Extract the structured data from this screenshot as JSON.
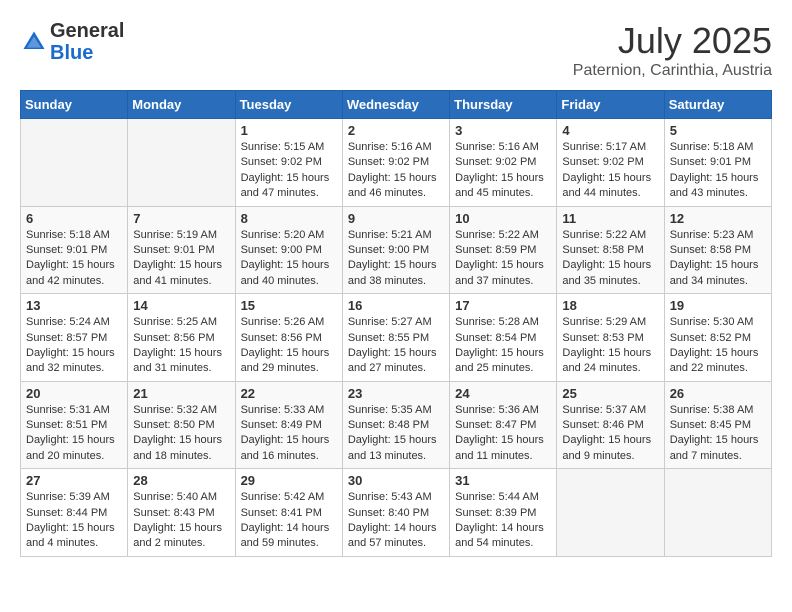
{
  "header": {
    "logo_general": "General",
    "logo_blue": "Blue",
    "month_year": "July 2025",
    "location": "Paternion, Carinthia, Austria"
  },
  "weekdays": [
    "Sunday",
    "Monday",
    "Tuesday",
    "Wednesday",
    "Thursday",
    "Friday",
    "Saturday"
  ],
  "weeks": [
    [
      {
        "day": "",
        "empty": true
      },
      {
        "day": "",
        "empty": true
      },
      {
        "day": "1",
        "sunrise": "5:15 AM",
        "sunset": "9:02 PM",
        "daylight": "15 hours and 47 minutes."
      },
      {
        "day": "2",
        "sunrise": "5:16 AM",
        "sunset": "9:02 PM",
        "daylight": "15 hours and 46 minutes."
      },
      {
        "day": "3",
        "sunrise": "5:16 AM",
        "sunset": "9:02 PM",
        "daylight": "15 hours and 45 minutes."
      },
      {
        "day": "4",
        "sunrise": "5:17 AM",
        "sunset": "9:02 PM",
        "daylight": "15 hours and 44 minutes."
      },
      {
        "day": "5",
        "sunrise": "5:18 AM",
        "sunset": "9:01 PM",
        "daylight": "15 hours and 43 minutes."
      }
    ],
    [
      {
        "day": "6",
        "sunrise": "5:18 AM",
        "sunset": "9:01 PM",
        "daylight": "15 hours and 42 minutes."
      },
      {
        "day": "7",
        "sunrise": "5:19 AM",
        "sunset": "9:01 PM",
        "daylight": "15 hours and 41 minutes."
      },
      {
        "day": "8",
        "sunrise": "5:20 AM",
        "sunset": "9:00 PM",
        "daylight": "15 hours and 40 minutes."
      },
      {
        "day": "9",
        "sunrise": "5:21 AM",
        "sunset": "9:00 PM",
        "daylight": "15 hours and 38 minutes."
      },
      {
        "day": "10",
        "sunrise": "5:22 AM",
        "sunset": "8:59 PM",
        "daylight": "15 hours and 37 minutes."
      },
      {
        "day": "11",
        "sunrise": "5:22 AM",
        "sunset": "8:58 PM",
        "daylight": "15 hours and 35 minutes."
      },
      {
        "day": "12",
        "sunrise": "5:23 AM",
        "sunset": "8:58 PM",
        "daylight": "15 hours and 34 minutes."
      }
    ],
    [
      {
        "day": "13",
        "sunrise": "5:24 AM",
        "sunset": "8:57 PM",
        "daylight": "15 hours and 32 minutes."
      },
      {
        "day": "14",
        "sunrise": "5:25 AM",
        "sunset": "8:56 PM",
        "daylight": "15 hours and 31 minutes."
      },
      {
        "day": "15",
        "sunrise": "5:26 AM",
        "sunset": "8:56 PM",
        "daylight": "15 hours and 29 minutes."
      },
      {
        "day": "16",
        "sunrise": "5:27 AM",
        "sunset": "8:55 PM",
        "daylight": "15 hours and 27 minutes."
      },
      {
        "day": "17",
        "sunrise": "5:28 AM",
        "sunset": "8:54 PM",
        "daylight": "15 hours and 25 minutes."
      },
      {
        "day": "18",
        "sunrise": "5:29 AM",
        "sunset": "8:53 PM",
        "daylight": "15 hours and 24 minutes."
      },
      {
        "day": "19",
        "sunrise": "5:30 AM",
        "sunset": "8:52 PM",
        "daylight": "15 hours and 22 minutes."
      }
    ],
    [
      {
        "day": "20",
        "sunrise": "5:31 AM",
        "sunset": "8:51 PM",
        "daylight": "15 hours and 20 minutes."
      },
      {
        "day": "21",
        "sunrise": "5:32 AM",
        "sunset": "8:50 PM",
        "daylight": "15 hours and 18 minutes."
      },
      {
        "day": "22",
        "sunrise": "5:33 AM",
        "sunset": "8:49 PM",
        "daylight": "15 hours and 16 minutes."
      },
      {
        "day": "23",
        "sunrise": "5:35 AM",
        "sunset": "8:48 PM",
        "daylight": "15 hours and 13 minutes."
      },
      {
        "day": "24",
        "sunrise": "5:36 AM",
        "sunset": "8:47 PM",
        "daylight": "15 hours and 11 minutes."
      },
      {
        "day": "25",
        "sunrise": "5:37 AM",
        "sunset": "8:46 PM",
        "daylight": "15 hours and 9 minutes."
      },
      {
        "day": "26",
        "sunrise": "5:38 AM",
        "sunset": "8:45 PM",
        "daylight": "15 hours and 7 minutes."
      }
    ],
    [
      {
        "day": "27",
        "sunrise": "5:39 AM",
        "sunset": "8:44 PM",
        "daylight": "15 hours and 4 minutes."
      },
      {
        "day": "28",
        "sunrise": "5:40 AM",
        "sunset": "8:43 PM",
        "daylight": "15 hours and 2 minutes."
      },
      {
        "day": "29",
        "sunrise": "5:42 AM",
        "sunset": "8:41 PM",
        "daylight": "14 hours and 59 minutes."
      },
      {
        "day": "30",
        "sunrise": "5:43 AM",
        "sunset": "8:40 PM",
        "daylight": "14 hours and 57 minutes."
      },
      {
        "day": "31",
        "sunrise": "5:44 AM",
        "sunset": "8:39 PM",
        "daylight": "14 hours and 54 minutes."
      },
      {
        "day": "",
        "empty": true
      },
      {
        "day": "",
        "empty": true
      }
    ]
  ]
}
